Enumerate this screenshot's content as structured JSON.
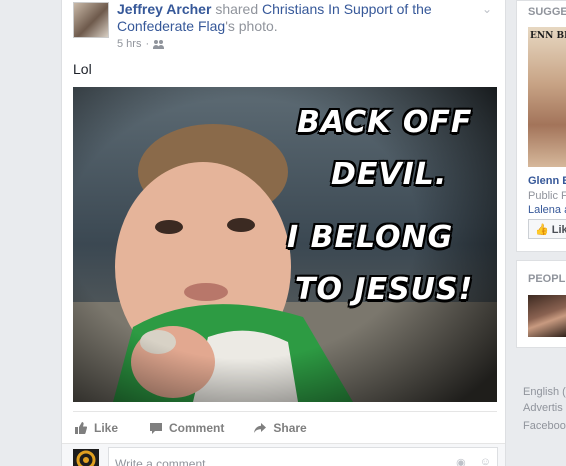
{
  "post": {
    "author": "Jeffrey Archer",
    "action_text": "shared",
    "target": "Christians In Support of the Confederate Flag",
    "target_suffix": "'s photo.",
    "time": "5 hrs",
    "separator": "·",
    "status": "Lol",
    "meme_lines": [
      "BACK OFF",
      "DEVIL.",
      "I BELONG",
      "TO JESUS!"
    ],
    "actions": {
      "like": "Like",
      "comment": "Comment",
      "share": "Share"
    },
    "comment_placeholder": "Write a comment..."
  },
  "sidebar": {
    "suggested_title": "SUGGE",
    "suggested_image_text": "ENN BECK",
    "suggested_name": "Glenn B",
    "suggested_category": "Public F",
    "suggested_friend": "Lalena a",
    "like_button": "Lik",
    "people_title": "PEOPLE"
  },
  "footer": {
    "language": "English (",
    "advertising": "Advertis",
    "facebook": "Faceboo"
  },
  "colors": {
    "link": "#365899",
    "muted": "#90949c",
    "background": "#e9ebee"
  }
}
